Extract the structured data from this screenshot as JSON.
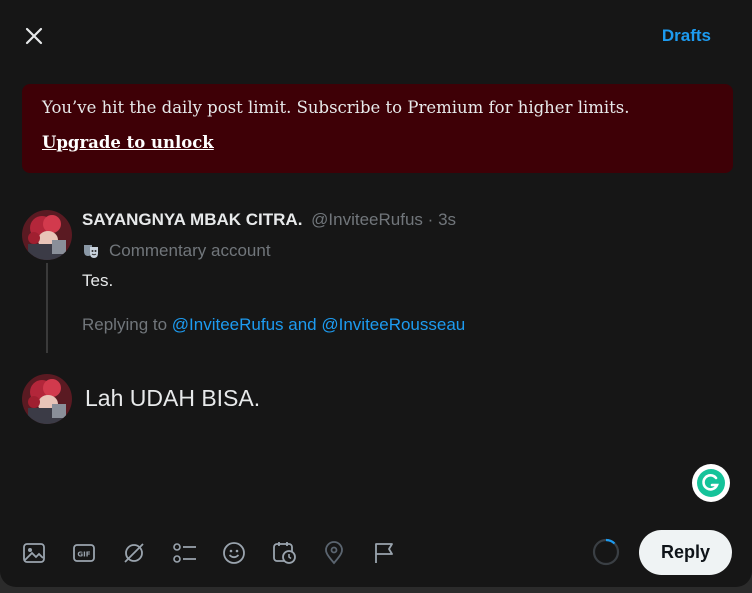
{
  "header": {
    "close_icon": "close-icon",
    "drafts_label": "Drafts"
  },
  "banner": {
    "message": "You’ve hit the daily post limit. Subscribe to Premium for higher limits.",
    "link": "Upgrade to unlock"
  },
  "tweet": {
    "display_name": "SAYANGNYA MBAK CITRA.",
    "handle": "@InviteeRufus",
    "separator": "·",
    "time": "3s",
    "badge_label": "Commentary account",
    "text": "Tes.",
    "replying_prefix": "Replying to",
    "replying_mentions": "@InviteeRufus and @InviteeRousseau"
  },
  "compose": {
    "text": "Lah UDAH BISA."
  },
  "toolbar": {
    "icons": [
      "image-icon",
      "gif-icon",
      "grok-icon",
      "poll-icon",
      "emoji-icon",
      "schedule-icon",
      "location-icon",
      "flag-icon"
    ],
    "reply_label": "Reply"
  },
  "colors": {
    "accent": "#1d9bf0",
    "banner_bg": "#3e0006",
    "modal_bg": "#161616",
    "muted": "#71767b"
  }
}
